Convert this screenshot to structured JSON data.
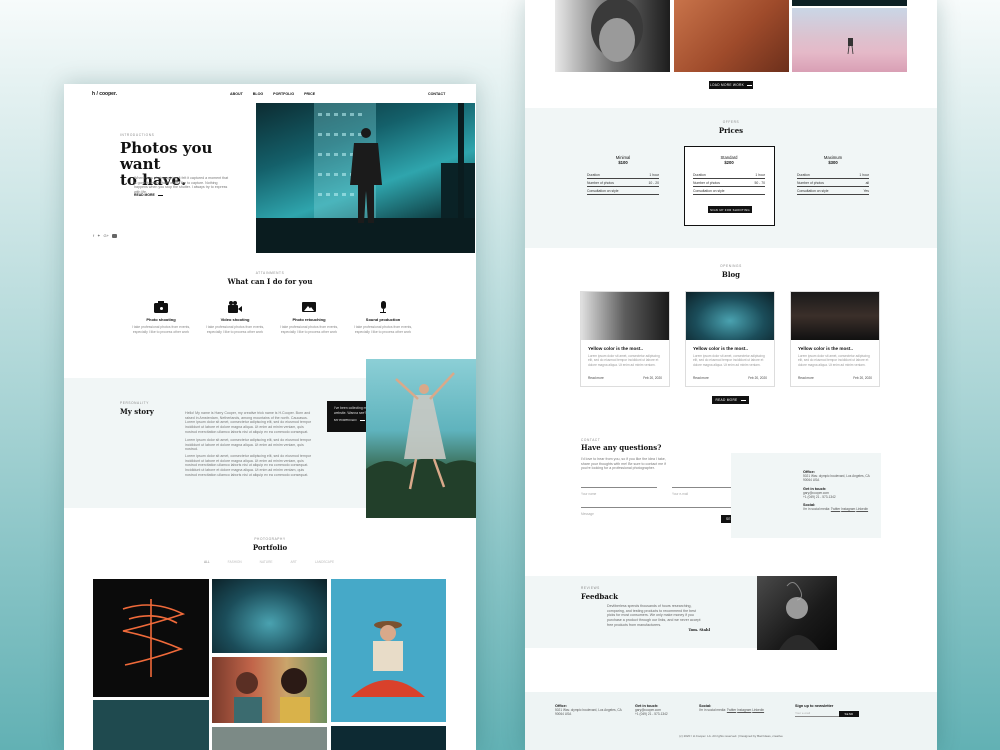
{
  "colors": {
    "accent": "#3cb8c4",
    "dark": "#111111",
    "panel": "#f1f6f6"
  },
  "brand": {
    "logo": "h / cooper."
  },
  "nav": {
    "items": [
      {
        "label": "ABOUT"
      },
      {
        "label": "BLOG"
      },
      {
        "label": "PORTFOLIO"
      },
      {
        "label": "PRICE"
      }
    ],
    "contact": "CONTACT"
  },
  "hero": {
    "eyebrow": "INTRODUCTIONS",
    "title_line1": "Photos you want",
    "title_line2": "to have.",
    "body": "When I was photographing, it felt it captured a moment that is gone forever. That's what I like to capture. Nothing happens when you stop the shutter. I always try to express with life.",
    "cta": "READ MORE",
    "socials": [
      "facebook-icon",
      "twitter-icon",
      "google-plus-icon",
      "youtube-icon"
    ]
  },
  "services": {
    "eyebrow": "ATTAINMENTS",
    "title": "What can I do for you",
    "items": [
      {
        "icon": "camera-icon",
        "title": "Photo shooting",
        "text": "I take professional photos from events, especially I like to process other work"
      },
      {
        "icon": "video-camera-icon",
        "title": "Video shooting",
        "text": "I take professional photos from events, especially I like to process other work"
      },
      {
        "icon": "image-icon",
        "title": "Photo retouching",
        "text": "I take professional photos from events, especially I like to process other work"
      },
      {
        "icon": "microphone-icon",
        "title": "Sound production",
        "text": "I take professional photos from events, especially I like to process other work"
      }
    ]
  },
  "story": {
    "eyebrow": "PERSONALITY",
    "title": "My story",
    "p1": "Hello! My name is Harry Cooper, my creative trick name is H.Cooper. Born and raised in Amsterdam, Netherlands, among mountains of the north. Caucasus. Lorem ipsum dolor sit amet, consectetur adipiscing elit, sed do eiusmod tempor incididunt ut labore et dolore magna aliqua. Ut enim ad minim veniam, quis nostrud exercitation ullamco laboris nisi ut aliquip ex ea commodo consequat.",
    "p2": "Lorem ipsum dolor sit amet, consectetur adipiscing elit, sed do eiusmod tempor incididunt ut labore et dolore magna aliqua. Ut enim ad minim veniam, quis nostrud.",
    "p3": "Lorem ipsum dolor sit amet, consectetur adipiscing elit, sed do eiusmod tempor incididunt ut labore et dolore magna aliqua. Ut enim ad minim veniam, quis nostrud exercitation ullamco laboris nisi ut aliquip ex ea commodo consequat. Incididunt ut labore et dolore magna aliqua. Ut enim ad minim veniam, quis nostrud exercitation ullamco laboris nisi ut aliquip ex ea commodo consequat.",
    "quote": "I've been collecting my work on this website. Wanna see?",
    "quote_link": "MY PORTFOLIO"
  },
  "portfolio": {
    "eyebrow": "PHOTOGRAPHY",
    "title": "Portfolio",
    "filters": [
      "ALL",
      "FASHION",
      "NATURE",
      "ART",
      "LANDSCAPE"
    ]
  },
  "top": {
    "load_more": "LOAD MORE WORK"
  },
  "prices": {
    "eyebrow": "OFFERS",
    "title": "Prices",
    "plans": [
      {
        "name": "Minimal",
        "price": "$100",
        "rows": [
          {
            "k": "Duration",
            "v": "1 hour"
          },
          {
            "k": "Number of photos",
            "v": "10 - 20"
          },
          {
            "k": "Consultation on style",
            "v": ""
          }
        ]
      },
      {
        "name": "Standard",
        "price": "$200",
        "rows": [
          {
            "k": "Duration",
            "v": "1 hour"
          },
          {
            "k": "Number of photos",
            "v": "50 - 70"
          },
          {
            "k": "Consultation on style",
            "v": ""
          }
        ],
        "cta": "SIGN UP FOR SHOOTING"
      },
      {
        "name": "Maximum",
        "price": "$300",
        "rows": [
          {
            "k": "Duration",
            "v": "1 hour"
          },
          {
            "k": "Number of photos",
            "v": "all"
          },
          {
            "k": "Consultation on style",
            "v": "Yes"
          }
        ]
      }
    ]
  },
  "blog": {
    "eyebrow": "OPENINGS",
    "title": "Blog",
    "read_more": "READ MORE",
    "cards": [
      {
        "title": "Yellow color is the most..",
        "text": "Lorem ipsum dolor sit amet, consectetur adipiscing elit, sed do eiusmod tempor incididunt ut labore et dolore magna aliqua. Ut enim ad minim veniam.",
        "link": "Read more",
        "date": "Feb 20, 2020"
      },
      {
        "title": "Yellow color is the most..",
        "text": "Lorem ipsum dolor sit amet, consectetur adipiscing elit, sed do eiusmod tempor incididunt ut labore et dolore magna aliqua. Ut enim ad minim veniam.",
        "link": "Read more",
        "date": "Feb 20, 2020"
      },
      {
        "title": "Yellow color is the most..",
        "text": "Lorem ipsum dolor sit amet, consectetur adipiscing elit, sed do eiusmod tempor incididunt ut labore et dolore magna aliqua. Ut enim ad minim veniam.",
        "link": "Read more",
        "date": "Feb 20, 2020"
      }
    ]
  },
  "contact": {
    "eyebrow": "CONTACT",
    "title": "Have any questions?",
    "intro": "I'd love to hear from you, so if you like the idea I take, share your thoughts with me! Be sure to contact me if you're looking for a professional photographer.",
    "name_placeholder": "Your name",
    "email_placeholder": "Your e-mail",
    "message_placeholder": "Message",
    "send": "SEND",
    "office_h": "Office:",
    "office_t": "5021 Wav. olympic boulevard, Los Angeles, CA 90064 USA",
    "touch_h": "Get in touch:",
    "touch_t1": "gary@cooper.com",
    "touch_t2": "+1 (049) 21 - 573-1342",
    "social_h": "Social:",
    "social_t": "I'm in social media:",
    "social_links": [
      "Twitter",
      "Instagram",
      "Linkedin"
    ]
  },
  "feedback": {
    "eyebrow": "REVIEWS",
    "title": "Feedback",
    "quote": "Devliberless spends thousands of hours researching, comparing, and testing products to recommend the best picks for most consumers. We only make money if you purchase a product through our links, and we never accept free products from manufacturers.",
    "author": "Tom. Stahl"
  },
  "footer": {
    "office_h": "Office:",
    "office_t": "5021 Wav. olympic boulevard, Los Angeles, CA 90064 USA",
    "touch_h": "Get in touch:",
    "touch_t1": "gary@cooper.com",
    "touch_t2": "+1 (049) 21 - 573-1342",
    "social_h": "Social:",
    "social_t": "I'm in social media:",
    "social_links": [
      "Twitter",
      "Instagram",
      "Linkedin"
    ],
    "news_h": "Sign up to newsletter",
    "news_placeholder": "Your e-mail",
    "news_btn": "SEND",
    "copyright": "(c) 2020 / H.Cooper. LA. All rights reserved. | Designed by Bad Ideas, creative"
  }
}
